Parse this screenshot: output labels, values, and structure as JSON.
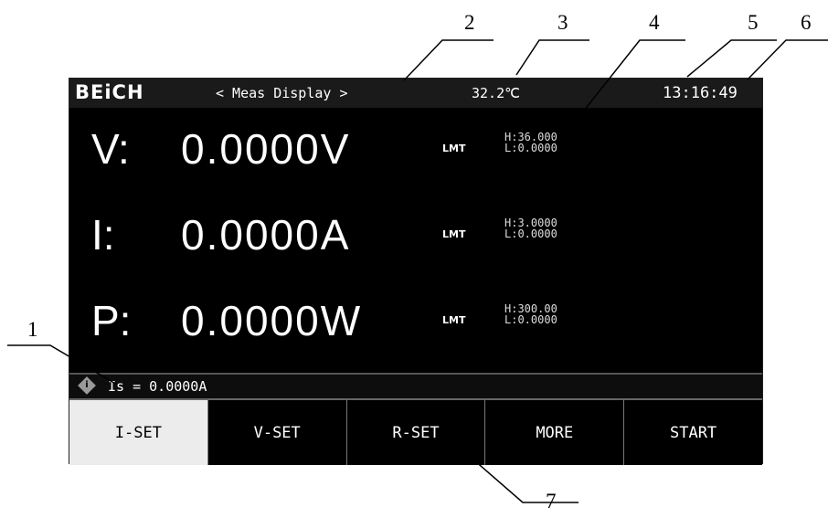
{
  "header": {
    "brand": "BEiCH",
    "title": "< Meas Display >",
    "temperature": "32.2℃",
    "time": "13:16:49"
  },
  "readings": [
    {
      "symbol": "V:",
      "value": "0.0000V",
      "limit_label": "LMT",
      "high": "H:36.000",
      "low": "L:0.0000"
    },
    {
      "symbol": "I:",
      "value": "0.0000A",
      "limit_label": "LMT",
      "high": "H:3.0000",
      "low": "L:0.0000"
    },
    {
      "symbol": "P:",
      "value": "0.0000W",
      "limit_label": "LMT",
      "high": "H:300.00",
      "low": "L:0.0000"
    }
  ],
  "status_bar": {
    "icon": "info-icon",
    "text": "Is = 0.0000A"
  },
  "softkeys": [
    "I-SET",
    "V-SET",
    "R-SET",
    "MORE",
    "START"
  ],
  "callouts": [
    "1",
    "2",
    "3",
    "4",
    "5",
    "6",
    "7"
  ]
}
